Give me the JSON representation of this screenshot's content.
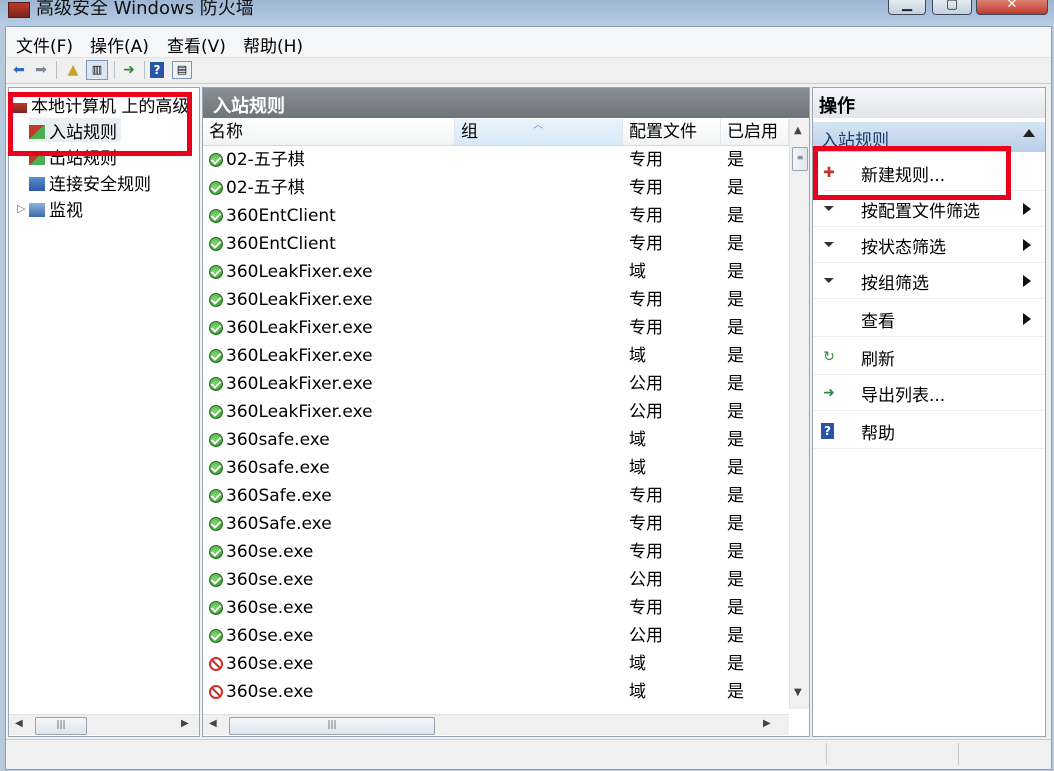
{
  "window": {
    "title": "高级安全 Windows 防火墙",
    "controls": {
      "minimize": "▁",
      "maximize": "▢",
      "close": "✕"
    }
  },
  "menu": [
    "文件(F)",
    "操作(A)",
    "查看(V)",
    "帮助(H)"
  ],
  "toolbar_icons": [
    "back-arrow-icon",
    "forward-arrow-icon",
    "up-folder-icon",
    "show-hide-tree-icon",
    "export-icon",
    "help-icon",
    "properties-icon"
  ],
  "tree": {
    "root": "本地计算机 上的高级",
    "items": [
      "入站规则",
      "出站规则",
      "连接安全规则",
      "监视"
    ],
    "selected": "入站规则"
  },
  "list": {
    "title": "入站规则",
    "columns": [
      "名称",
      "组",
      "配置文件",
      "已启用"
    ],
    "rows": [
      {
        "status": "allow",
        "name": "02-五子棋",
        "group": "",
        "profile": "专用",
        "enabled": "是"
      },
      {
        "status": "allow",
        "name": "02-五子棋",
        "group": "",
        "profile": "专用",
        "enabled": "是"
      },
      {
        "status": "allow",
        "name": "360EntClient",
        "group": "",
        "profile": "专用",
        "enabled": "是"
      },
      {
        "status": "allow",
        "name": "360EntClient",
        "group": "",
        "profile": "专用",
        "enabled": "是"
      },
      {
        "status": "allow",
        "name": "360LeakFixer.exe",
        "group": "",
        "profile": "域",
        "enabled": "是"
      },
      {
        "status": "allow",
        "name": "360LeakFixer.exe",
        "group": "",
        "profile": "专用",
        "enabled": "是"
      },
      {
        "status": "allow",
        "name": "360LeakFixer.exe",
        "group": "",
        "profile": "专用",
        "enabled": "是"
      },
      {
        "status": "allow",
        "name": "360LeakFixer.exe",
        "group": "",
        "profile": "域",
        "enabled": "是"
      },
      {
        "status": "allow",
        "name": "360LeakFixer.exe",
        "group": "",
        "profile": "公用",
        "enabled": "是"
      },
      {
        "status": "allow",
        "name": "360LeakFixer.exe",
        "group": "",
        "profile": "公用",
        "enabled": "是"
      },
      {
        "status": "allow",
        "name": "360safe.exe",
        "group": "",
        "profile": "域",
        "enabled": "是"
      },
      {
        "status": "allow",
        "name": "360safe.exe",
        "group": "",
        "profile": "域",
        "enabled": "是"
      },
      {
        "status": "allow",
        "name": "360Safe.exe",
        "group": "",
        "profile": "专用",
        "enabled": "是"
      },
      {
        "status": "allow",
        "name": "360Safe.exe",
        "group": "",
        "profile": "专用",
        "enabled": "是"
      },
      {
        "status": "allow",
        "name": "360se.exe",
        "group": "",
        "profile": "专用",
        "enabled": "是"
      },
      {
        "status": "allow",
        "name": "360se.exe",
        "group": "",
        "profile": "公用",
        "enabled": "是"
      },
      {
        "status": "allow",
        "name": "360se.exe",
        "group": "",
        "profile": "专用",
        "enabled": "是"
      },
      {
        "status": "allow",
        "name": "360se.exe",
        "group": "",
        "profile": "公用",
        "enabled": "是"
      },
      {
        "status": "block",
        "name": "360se.exe",
        "group": "",
        "profile": "域",
        "enabled": "是"
      },
      {
        "status": "block",
        "name": "360se.exe",
        "group": "",
        "profile": "域",
        "enabled": "是"
      }
    ]
  },
  "actions": {
    "title": "操作",
    "section": "入站规则",
    "items": [
      {
        "label": "新建规则...",
        "icon": "new-rule-icon",
        "glyph": "✚",
        "color": "#c0392b",
        "submenu": false
      },
      {
        "label": "按配置文件筛选",
        "icon": "filter-icon",
        "glyph": "⏷",
        "color": "#333333",
        "submenu": true
      },
      {
        "label": "按状态筛选",
        "icon": "filter-icon",
        "glyph": "⏷",
        "color": "#333333",
        "submenu": true
      },
      {
        "label": "按组筛选",
        "icon": "filter-icon",
        "glyph": "⏷",
        "color": "#333333",
        "submenu": true
      },
      {
        "label": "查看",
        "icon": "view-icon",
        "glyph": "",
        "color": "#333333",
        "submenu": true
      },
      {
        "label": "刷新",
        "icon": "refresh-icon",
        "glyph": "↻",
        "color": "#2e8b3a",
        "submenu": false
      },
      {
        "label": "导出列表...",
        "icon": "export-list-icon",
        "glyph": "➜",
        "color": "#2e8b3a",
        "submenu": false
      },
      {
        "label": "帮助",
        "icon": "help-icon",
        "glyph": "?",
        "color": "#ffffff",
        "submenu": false
      }
    ]
  },
  "colors": {
    "highlight_red": "#e8001c",
    "allow_green": "#2c8f27",
    "block_red": "#d1302a",
    "pane_header_gray": "#7c8188"
  }
}
